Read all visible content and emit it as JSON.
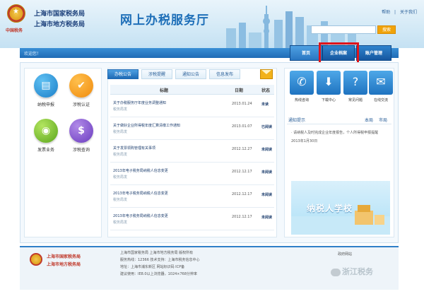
{
  "header": {
    "seal_text": "中国税务",
    "bureau_national": "上海市国家税务局",
    "bureau_local": "上海市地方税务局",
    "site_title": "网上办税服务厅",
    "top_links": [
      "帮助",
      "|",
      "关于我们"
    ],
    "search_placeholder": "",
    "search_button": "搜索"
  },
  "nav": {
    "breadcrumb": "欢迎您！",
    "tabs": [
      "首页",
      "企业档案",
      "账户管理"
    ]
  },
  "apps": [
    {
      "label": "纳税申报",
      "icon": "document-icon",
      "color": "#1b7fc9"
    },
    {
      "label": "涉税认证",
      "icon": "checklist-icon",
      "color": "#f08a0c"
    },
    {
      "label": "发票业务",
      "icon": "invoice-icon",
      "color": "#5aa51b"
    },
    {
      "label": "涉税查询",
      "icon": "query-icon",
      "color": "#6a3cbf"
    }
  ],
  "news": {
    "tabs": [
      "办税公告",
      "涉税提醒",
      "通知公告",
      "信息发布"
    ],
    "headers": {
      "title": "标题",
      "date": "日期",
      "status": "状态"
    },
    "rows": [
      {
        "title": "关于办税服务厅年度业务调整通知",
        "sub": "税务局发",
        "date": "2013.01.24",
        "status": "未读"
      },
      {
        "title": "关于做好企业所得税年度汇算清缴工作通知",
        "sub": "税务局发",
        "date": "2013.01.07",
        "status": "已阅读"
      },
      {
        "title": "关于发票领购管理有关事项",
        "sub": "税务局发",
        "date": "2012.12.27",
        "status": "未阅读"
      },
      {
        "title": "2013年电子税务局纳税人信息变更",
        "sub": "税务局发",
        "date": "2012.12.17",
        "status": "未阅读"
      },
      {
        "title": "2013年电子税务局纳税人信息变更",
        "sub": "税务局发",
        "date": "2012.12.17",
        "status": "未阅读"
      },
      {
        "title": "2013年电子税务局纳税人信息变更",
        "sub": "税务局发",
        "date": "2012.12.17",
        "status": "未阅读"
      }
    ]
  },
  "services": [
    {
      "label": "热线咨询",
      "icon": "phone-icon"
    },
    {
      "label": "下载中心",
      "icon": "download-icon"
    },
    {
      "label": "常见问题",
      "icon": "question-icon"
    },
    {
      "label": "在线交流",
      "icon": "chat-icon"
    }
  ],
  "notice": {
    "title": "通知提示",
    "tabs": [
      "本局",
      "市局"
    ],
    "lines": [
      "· 请纳税人及时完成企业年度报告，个人所得税申报提醒",
      "2013年1月30日"
    ]
  },
  "banner": {
    "text": "纳税人学校"
  },
  "footer": {
    "name_national": "上海市国家税务局",
    "name_local": "上海市地方税务局",
    "info_lines": [
      "上海市国家税务局  上海市地方税务局  版权所有",
      "服务热线：12366    技术支持：上海市税务信息中心",
      "地址：上海市浦东新区    网站标识码  ICP备",
      "建议使用：IE8.0以上浏览器，1024×768分辨率"
    ],
    "logo_text": "政府网站",
    "watermark": "浙江税务"
  }
}
